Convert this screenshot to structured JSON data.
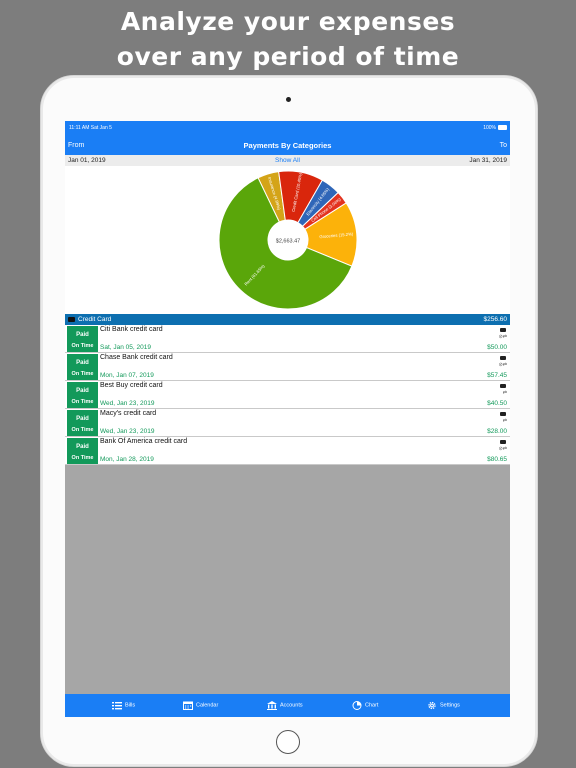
{
  "banner": {
    "line1": "Analyze your expenses",
    "line2": "over any period of time"
  },
  "status_bar": {
    "time": "11:11 AM  Sat Jan 5",
    "battery": "100%"
  },
  "nav": {
    "from": "From",
    "title": "Payments By Categories",
    "to": "To"
  },
  "date_range": {
    "start": "Jan 01, 2019",
    "show_all": "Show All",
    "end": "Jan 31, 2019"
  },
  "chart_data": {
    "type": "pie",
    "style": "donut",
    "center_label": "$2,663.47",
    "slices": [
      {
        "label": "Insurance (4.99%)",
        "value": 4.99,
        "color": "#d4a418"
      },
      {
        "label": "Credit Card (10.45%)",
        "value": 10.45,
        "color": "#d9260c"
      },
      {
        "label": "Electricity (4.65%)",
        "value": 4.65,
        "color": "#2f66b8"
      },
      {
        "label": "Cell Phone (3.04%)",
        "value": 3.04,
        "color": "#e3331f"
      },
      {
        "label": "Groceries (15.2%)",
        "value": 15.2,
        "color": "#fcb20a"
      },
      {
        "label": "Rent (61.65%)",
        "value": 61.65,
        "color": "#5aa60a"
      }
    ]
  },
  "section": {
    "label": "Credit Card",
    "amount": "$256.60"
  },
  "bills": [
    {
      "status1": "Paid",
      "status2": "On Time",
      "name": "Citi Bank credit card",
      "date": "Sat, Jan 05, 2019",
      "amount": "$50.00"
    },
    {
      "status1": "Paid",
      "status2": "On Time",
      "name": "Chase Bank credit card",
      "date": "Mon, Jan 07, 2019",
      "amount": "$57.45"
    },
    {
      "status1": "Paid",
      "status2": "On Time",
      "name": "Best Buy credit card",
      "date": "Wed, Jan 23, 2019",
      "amount": "$40.50"
    },
    {
      "status1": "Paid",
      "status2": "On Time",
      "name": "Macy's credit card",
      "date": "Wed, Jan 23, 2019",
      "amount": "$28.00"
    },
    {
      "status1": "Paid",
      "status2": "On Time",
      "name": "Bank Of America credit card",
      "date": "Mon, Jan 28, 2019",
      "amount": "$80.65"
    }
  ],
  "tabs": [
    {
      "label": "Bills",
      "icon": "list-icon"
    },
    {
      "label": "Calendar",
      "icon": "calendar-icon"
    },
    {
      "label": "Accounts",
      "icon": "bank-icon"
    },
    {
      "label": "Chart",
      "icon": "pie-chart-icon"
    },
    {
      "label": "Settings",
      "icon": "gear-icon"
    }
  ]
}
